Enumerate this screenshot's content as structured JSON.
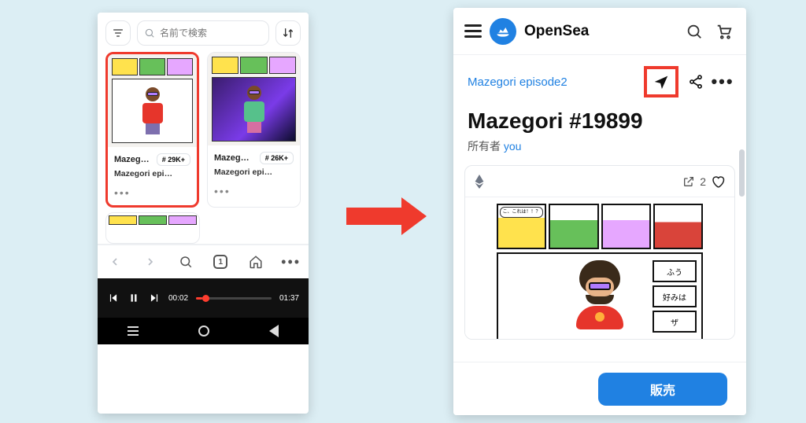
{
  "left": {
    "search_placeholder": "名前で検索",
    "cards": [
      {
        "name": "Mazeg…",
        "badge": "# 29K+",
        "sub": "Mazegori epi…"
      },
      {
        "name": "Mazeg…",
        "badge": "# 26K+",
        "sub": "Mazegori epi…"
      }
    ],
    "tab_count": "1",
    "media": {
      "elapsed": "00:02",
      "total": "01:37"
    }
  },
  "right": {
    "brand": "OpenSea",
    "collection": "Mazegori episode2",
    "title": "Mazegori #19899",
    "owner_label": "所有者",
    "owner_you": "you",
    "speech_bubble": "こ、これは！！？",
    "like_count": "2",
    "side_boxes": [
      "ふう",
      "好みは",
      "ザ"
    ],
    "sell_label": "販売"
  }
}
